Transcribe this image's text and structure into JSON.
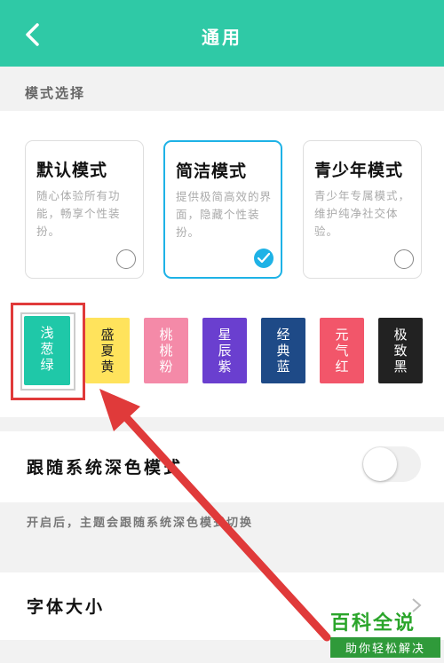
{
  "header": {
    "title": "通用",
    "back_icon": "chevron-left-icon"
  },
  "mode_section": {
    "label": "模式选择",
    "cards": [
      {
        "title": "默认模式",
        "desc": "随心体验所有功能，畅享个性装扮。",
        "selected": false
      },
      {
        "title": "简洁模式",
        "desc": "提供极简高效的界面，隐藏个性装扮。",
        "selected": true
      },
      {
        "title": "青少年模式",
        "desc": "青少年专属模式，维护纯净社交体验。",
        "selected": false
      }
    ]
  },
  "themes": [
    {
      "label": "浅\n葱\n绿",
      "color": "#1fc8a8",
      "selected": true
    },
    {
      "label": "盛\n夏\n黄",
      "color": "#ffe35c"
    },
    {
      "label": "桃\n桃\n粉",
      "color": "#f48aa8"
    },
    {
      "label": "星\n辰\n紫",
      "color": "#6a3fcf"
    },
    {
      "label": "经\n典\n蓝",
      "color": "#1e4a87"
    },
    {
      "label": "元\n气\n红",
      "color": "#f2566a"
    },
    {
      "label": "极\n致\n黑",
      "color": "#222222"
    }
  ],
  "dark_mode": {
    "label": "跟随系统深色模式",
    "enabled": false,
    "note": "开启后，主题会跟随系统深色模式切换"
  },
  "font_size": {
    "label": "字体大小"
  },
  "watermark": {
    "title": "百科全说",
    "subtitle": "助你轻松解决"
  },
  "colors": {
    "accent": "#2fc9a6",
    "check_blue": "#1eb2e6",
    "annotation_red": "#e03a3a"
  }
}
